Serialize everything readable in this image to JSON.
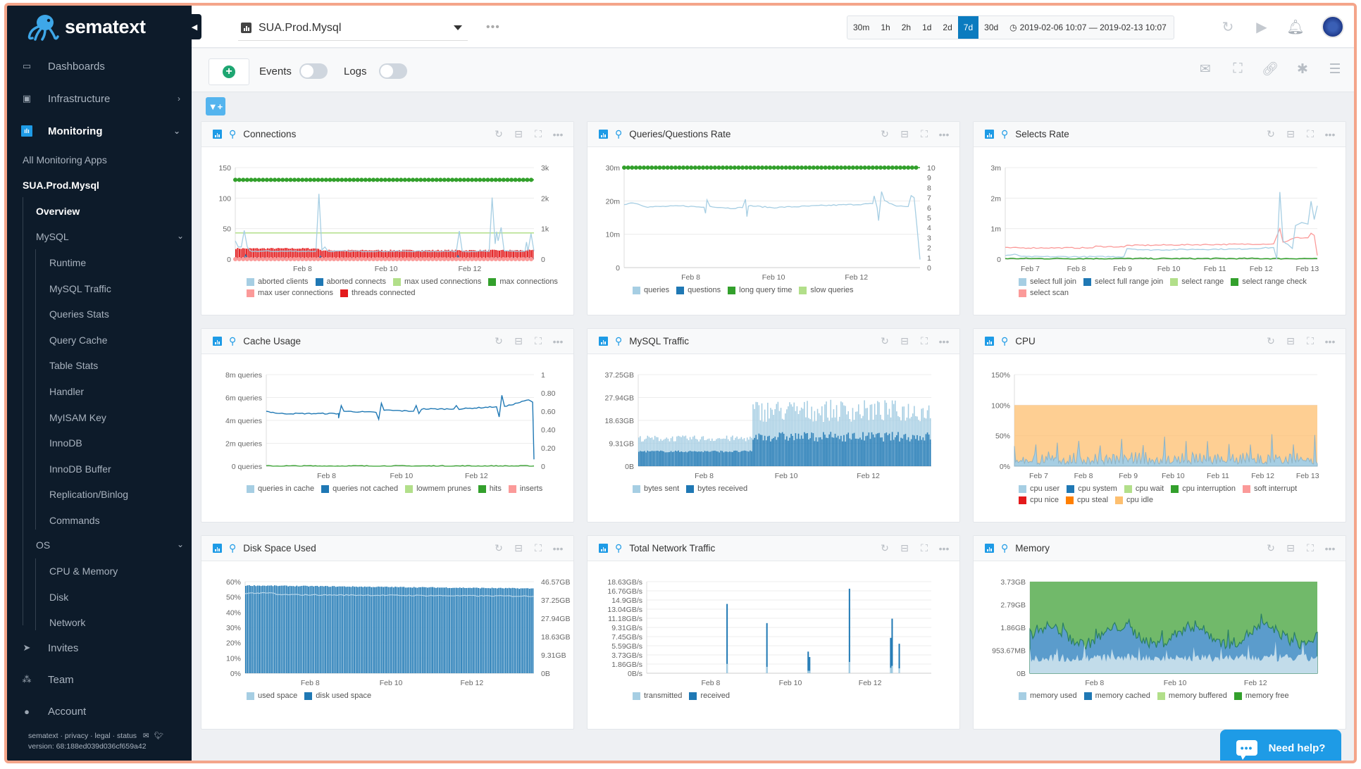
{
  "brand": {
    "name": "sematext",
    "accent": "#1e9be6",
    "sidebar_bg": "#0d1b2a"
  },
  "sidebar": {
    "main_items": [
      {
        "label": "Dashboards",
        "icon": "dashboard-icon"
      },
      {
        "label": "Infrastructure",
        "icon": "infrastructure-icon",
        "chevron": "›"
      },
      {
        "label": "Monitoring",
        "icon": "monitoring-icon",
        "chevron": "⌄",
        "active": true
      }
    ],
    "all_apps": "All Monitoring Apps",
    "current_app": "SUA.Prod.Mysql",
    "overview": "Overview",
    "mysql_group": "MySQL",
    "mysql_items": [
      "Runtime",
      "MySQL Traffic",
      "Queries Stats",
      "Query Cache",
      "Table Stats",
      "Handler",
      "MyISAM Key",
      "InnoDB",
      "InnoDB Buffer",
      "Replication/Binlog",
      "Commands"
    ],
    "os_group": "OS",
    "os_items": [
      "CPU & Memory",
      "Disk",
      "Network"
    ],
    "bottom_items": [
      {
        "label": "Invites",
        "icon": "send-icon"
      },
      {
        "label": "Team",
        "icon": "team-icon"
      },
      {
        "label": "Account",
        "icon": "user-icon"
      }
    ],
    "footer_links": "sematext · privacy · legal · status",
    "version": "version: 68:188ed039d036cf659a42"
  },
  "topbar": {
    "app_name": "SUA.Prod.Mysql",
    "more": "•••",
    "ranges": [
      "30m",
      "1h",
      "2h",
      "1d",
      "2d",
      "7d",
      "30d"
    ],
    "selected_range": "7d",
    "date_range": "2019-02-06 10:07 — 2019-02-13 10:07"
  },
  "toolbar": {
    "events_label": "Events",
    "logs_label": "Logs",
    "events_on": false,
    "logs_on": false
  },
  "help": {
    "label": "Need help?"
  },
  "chart_data": [
    {
      "id": "connections",
      "title": "Connections",
      "type": "line",
      "yticks_left": [
        "150",
        "100",
        "50",
        "0"
      ],
      "yticks_right": [
        "3k",
        "2k",
        "1k",
        "0"
      ],
      "ylim": [
        0,
        150
      ],
      "xticks": [
        "Feb 8",
        "Feb 10",
        "Feb 12"
      ],
      "series": [
        {
          "name": "aborted clients",
          "color": "#a6cee3"
        },
        {
          "name": "aborted connects",
          "color": "#1f78b4"
        },
        {
          "name": "max used connections",
          "color": "#b2df8a"
        },
        {
          "name": "max connections",
          "color": "#33a02c"
        },
        {
          "name": "max user connections",
          "color": "#fb9a99"
        },
        {
          "name": "threads connected",
          "color": "#e31a1c"
        }
      ],
      "levels": {
        "max connections": 130,
        "max used connections": 43,
        "threads connected": 14,
        "aborted clients baseline": 13,
        "max user connections": 0
      },
      "spikes": {
        "aborted clients": [
          [
            0.03,
            47
          ],
          [
            0.28,
            107
          ],
          [
            0.75,
            46
          ],
          [
            0.86,
            101
          ],
          [
            0.89,
            52
          ],
          [
            0.99,
            42
          ]
        ]
      }
    },
    {
      "id": "queries",
      "title": "Queries/Questions Rate",
      "type": "line",
      "yticks_left": [
        "30m",
        "20m",
        "10m",
        "0"
      ],
      "yticks_right": [
        "10",
        "9",
        "8",
        "7",
        "6",
        "5",
        "4",
        "3",
        "2",
        "1",
        "0"
      ],
      "ylim": [
        0,
        30
      ],
      "xticks": [
        "Feb 8",
        "Feb 10",
        "Feb 12"
      ],
      "series": [
        {
          "name": "queries",
          "color": "#a6cee3"
        },
        {
          "name": "questions",
          "color": "#1f78b4"
        },
        {
          "name": "long query time",
          "color": "#33a02c"
        },
        {
          "name": "slow queries",
          "color": "#b2df8a"
        }
      ],
      "levels": {
        "long query time": 30,
        "queries": 18.5
      },
      "spikes": {
        "queries": [
          [
            0.28,
            20.3
          ],
          [
            0.28,
            16.5
          ],
          [
            0.42,
            20.5
          ],
          [
            0.42,
            15.3
          ],
          [
            0.85,
            21.5
          ],
          [
            0.87,
            14.1
          ],
          [
            0.88,
            22.8
          ],
          [
            0.98,
            21.6
          ],
          [
            1.0,
            2.4
          ]
        ]
      }
    },
    {
      "id": "selects",
      "title": "Selects Rate",
      "type": "line",
      "yticks_left": [
        "3m",
        "2m",
        "1m",
        "0"
      ],
      "ylim": [
        0,
        3
      ],
      "xticks": [
        "Feb 7",
        "Feb 8",
        "Feb 9",
        "Feb 10",
        "Feb 11",
        "Feb 12",
        "Feb 13"
      ],
      "series": [
        {
          "name": "select full join",
          "color": "#a6cee3"
        },
        {
          "name": "select full range join",
          "color": "#1f78b4"
        },
        {
          "name": "select range",
          "color": "#b2df8a"
        },
        {
          "name": "select range check",
          "color": "#33a02c"
        },
        {
          "name": "select scan",
          "color": "#fb9a99"
        }
      ],
      "points": {
        "select full join": [
          [
            0,
            0.12
          ],
          [
            0.03,
            0.15
          ],
          [
            0.06,
            0.08
          ],
          [
            0.38,
            0.08
          ],
          [
            0.39,
            0.35
          ],
          [
            0.45,
            0.3
          ],
          [
            0.6,
            0.32
          ],
          [
            0.75,
            0.33
          ],
          [
            0.86,
            0.38
          ],
          [
            0.87,
            0.0
          ],
          [
            0.88,
            2.2
          ],
          [
            0.89,
            0.6
          ],
          [
            0.92,
            0.35
          ],
          [
            0.93,
            1.1
          ],
          [
            0.95,
            1.2
          ],
          [
            0.97,
            1.15
          ],
          [
            0.98,
            1.9
          ],
          [
            0.99,
            1.3
          ],
          [
            1.0,
            1.75
          ]
        ],
        "select scan": [
          [
            0,
            0.37
          ],
          [
            0.28,
            0.37
          ],
          [
            0.29,
            0.42
          ],
          [
            0.38,
            0.4
          ],
          [
            0.39,
            0.45
          ],
          [
            0.86,
            0.5
          ],
          [
            0.88,
            1.0
          ],
          [
            0.89,
            0.55
          ],
          [
            0.93,
            0.7
          ],
          [
            0.97,
            0.7
          ],
          [
            0.98,
            0.85
          ],
          [
            0.99,
            0.78
          ],
          [
            1.0,
            0.12
          ]
        ],
        "select range check": [
          [
            0,
            0.02
          ],
          [
            1.0,
            0.02
          ]
        ]
      }
    },
    {
      "id": "cache",
      "title": "Cache Usage",
      "type": "line",
      "yticks_left": [
        "8m queries",
        "6m queries",
        "4m queries",
        "2m queries",
        "0 queries"
      ],
      "yticks_right": [
        "1",
        "0.80",
        "0.60",
        "0.40",
        "0.20",
        "0"
      ],
      "ylim": [
        0,
        8
      ],
      "xticks": [
        "Feb 8",
        "Feb 10",
        "Feb 12"
      ],
      "series": [
        {
          "name": "queries in cache",
          "color": "#a6cee3"
        },
        {
          "name": "queries not cached",
          "color": "#1f78b4"
        },
        {
          "name": "lowmem prunes",
          "color": "#b2df8a"
        },
        {
          "name": "hits",
          "color": "#33a02c"
        },
        {
          "name": "inserts",
          "color": "#fb9a99"
        }
      ],
      "points": {
        "queries not cached": [
          [
            0,
            4.8
          ],
          [
            0.05,
            4.6
          ],
          [
            0.27,
            4.6
          ],
          [
            0.27,
            4.2
          ],
          [
            0.28,
            5.3
          ],
          [
            0.29,
            4.8
          ],
          [
            0.41,
            4.7
          ],
          [
            0.42,
            4.1
          ],
          [
            0.43,
            5.5
          ],
          [
            0.44,
            4.9
          ],
          [
            0.55,
            4.8
          ],
          [
            0.56,
            5.3
          ],
          [
            0.57,
            4.6
          ],
          [
            0.58,
            5.0
          ],
          [
            0.7,
            5.0
          ],
          [
            0.71,
            5.3
          ],
          [
            0.72,
            5.0
          ],
          [
            0.86,
            5.2
          ],
          [
            0.87,
            4.3
          ],
          [
            0.88,
            6.2
          ],
          [
            0.89,
            5.2
          ],
          [
            0.98,
            5.8
          ],
          [
            0.995,
            5.6
          ],
          [
            1.0,
            0.6
          ]
        ]
      }
    },
    {
      "id": "mysql_traffic",
      "title": "MySQL Traffic",
      "type": "bar",
      "yticks_left": [
        "37.25GB",
        "27.94GB",
        "18.63GB",
        "9.31GB",
        "0B"
      ],
      "ylim": [
        0,
        37.25
      ],
      "xticks": [
        "Feb 8",
        "Feb 10",
        "Feb 12"
      ],
      "series": [
        {
          "name": "bytes sent",
          "color": "#a6cee3",
          "segments": [
            [
              0,
              0.39,
              11.5
            ],
            [
              0.39,
              1.0,
              22.5
            ]
          ]
        },
        {
          "name": "bytes received",
          "color": "#1f78b4",
          "segments": [
            [
              0,
              0.39,
              5.8
            ],
            [
              0.39,
              1.0,
              12
            ]
          ]
        }
      ]
    },
    {
      "id": "cpu",
      "title": "CPU",
      "type": "area",
      "yticks_left": [
        "150%",
        "100%",
        "50%",
        "0%"
      ],
      "ylim": [
        0,
        150
      ],
      "xticks": [
        "Feb 7",
        "Feb 8",
        "Feb 9",
        "Feb 10",
        "Feb 11",
        "Feb 12",
        "Feb 13"
      ],
      "series": [
        {
          "name": "cpu user",
          "color": "#a6cee3"
        },
        {
          "name": "cpu system",
          "color": "#1f78b4"
        },
        {
          "name": "cpu wait",
          "color": "#b2df8a"
        },
        {
          "name": "cpu interruption",
          "color": "#33a02c"
        },
        {
          "name": "soft interrupt",
          "color": "#fb9a99"
        },
        {
          "name": "cpu nice",
          "color": "#e31a1c"
        },
        {
          "name": "cpu steal",
          "color": "#ff7f00"
        },
        {
          "name": "cpu idle",
          "color": "#fdbf6f"
        }
      ],
      "levels": {
        "total": 100,
        "cpu user typical": 20,
        "cpu user peak": 55
      }
    },
    {
      "id": "disk",
      "title": "Disk Space Used",
      "type": "bar",
      "yticks_left": [
        "60%",
        "50%",
        "40%",
        "30%",
        "20%",
        "10%",
        "0%"
      ],
      "yticks_right": [
        "46.57GB",
        "37.25GB",
        "27.94GB",
        "18.63GB",
        "9.31GB",
        "0B"
      ],
      "ylim": [
        0,
        60
      ],
      "xticks": [
        "Feb 8",
        "Feb 10",
        "Feb 12"
      ],
      "series": [
        {
          "name": "used space",
          "color": "#a6cee3",
          "value_pct": 51.5
        },
        {
          "name": "disk used space",
          "color": "#1f78b4",
          "value_pct": 56
        }
      ]
    },
    {
      "id": "network",
      "title": "Total Network Traffic",
      "type": "bar",
      "yticks_left": [
        "18.63GB/s",
        "16.76GB/s",
        "14.9GB/s",
        "13.04GB/s",
        "11.18GB/s",
        "9.31GB/s",
        "7.45GB/s",
        "5.59GB/s",
        "3.73GB/s",
        "1.86GB/s",
        "0B/s"
      ],
      "ylim": [
        0,
        18.63
      ],
      "xticks": [
        "Feb 8",
        "Feb 10",
        "Feb 12"
      ],
      "series": [
        {
          "name": "transmitted",
          "color": "#a6cee3"
        },
        {
          "name": "received",
          "color": "#1f78b4"
        }
      ],
      "spikes": [
        [
          0.28,
          14.1,
          1.9
        ],
        [
          0.42,
          10.2,
          1.3
        ],
        [
          0.565,
          4.4,
          0.5
        ],
        [
          0.57,
          3.3,
          0.5
        ],
        [
          0.71,
          17.2,
          2.3
        ],
        [
          0.855,
          7.2,
          1.1
        ],
        [
          0.86,
          11.1,
          1.5
        ],
        [
          0.885,
          6.0,
          1.0
        ]
      ]
    },
    {
      "id": "memory",
      "title": "Memory",
      "type": "area",
      "yticks_left": [
        "3.73GB",
        "2.79GB",
        "1.86GB",
        "953.67MB",
        "0B"
      ],
      "ylim": [
        0,
        3.73
      ],
      "xticks": [
        "Feb 8",
        "Feb 10",
        "Feb 12"
      ],
      "series": [
        {
          "name": "memory used",
          "color": "#a6cee3"
        },
        {
          "name": "memory cached",
          "color": "#1f78b4"
        },
        {
          "name": "memory buffered",
          "color": "#b2df8a"
        },
        {
          "name": "memory free",
          "color": "#33a02c"
        }
      ],
      "levels": {
        "total": 3.73,
        "used typical": 0.55,
        "used+cached typical": 1.6
      }
    }
  ]
}
